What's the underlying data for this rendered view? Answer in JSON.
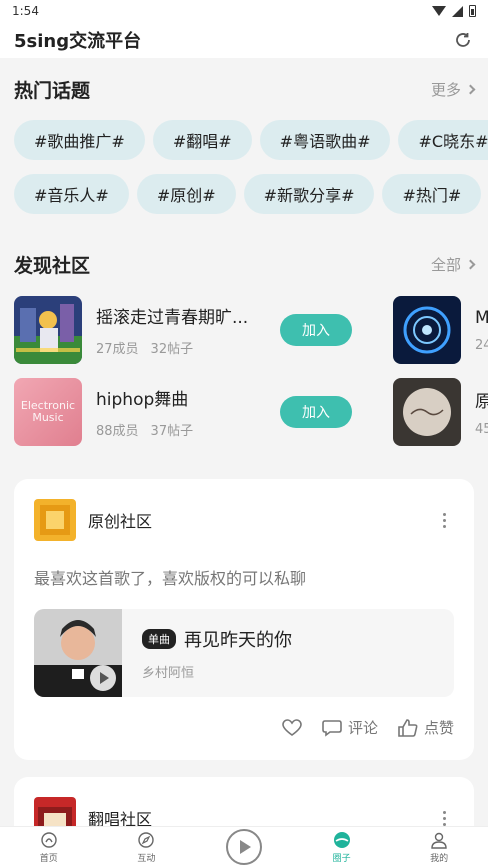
{
  "status_bar": {
    "time": "1:54"
  },
  "app_bar": {
    "title": "5sing交流平台"
  },
  "hot_topics": {
    "title": "热门话题",
    "more_label": "更多",
    "row1": [
      "#歌曲推广#",
      "#翻唱#",
      "#粤语歌曲#",
      "#C晓东#"
    ],
    "row2": [
      "#音乐人#",
      "#原创#",
      "#新歌分享#",
      "#热门#"
    ]
  },
  "discover": {
    "title": "发现社区",
    "all_label": "全部",
    "communities": [
      {
        "name": "摇滚走过青春期旷...",
        "members": "27成员",
        "posts": "32帖子",
        "join_label": "加入",
        "cover_text": ""
      },
      {
        "name": "hiphop舞曲",
        "members": "88成员",
        "posts": "37帖子",
        "join_label": "加入",
        "cover_text": "Electronic Music"
      }
    ],
    "right_communities": [
      {
        "name": "M",
        "stats": "24"
      },
      {
        "name": "原",
        "stats": "45"
      }
    ]
  },
  "post": {
    "community": "原创社区",
    "text": "最喜欢这首歌了，喜欢版权的可以私聊",
    "song": {
      "tag": "单曲",
      "title": "再见昨天的你",
      "artist": "乡村阿恒"
    },
    "actions": {
      "comment": "评论",
      "like": "点赞"
    }
  },
  "post2": {
    "community": "翻唱社区"
  },
  "bottom_nav": {
    "items": [
      {
        "label": "首页",
        "icon": "home-icon"
      },
      {
        "label": "互动",
        "icon": "compass-icon"
      },
      {
        "label": "",
        "icon": "play-icon"
      },
      {
        "label": "圈子",
        "icon": "circle-icon"
      },
      {
        "label": "我的",
        "icon": "profile-icon"
      }
    ]
  },
  "colors": {
    "accent": "#3ebfaf",
    "chip_bg": "#dcecef",
    "active_nav": "#1fb39b"
  }
}
